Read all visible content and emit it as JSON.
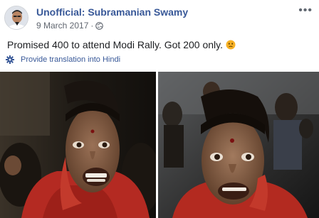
{
  "post": {
    "author": "Unofficial: Subramanian Swamy",
    "date": "9 March 2017",
    "separator": "·",
    "privacy_icon": "globe-icon",
    "more_icon": "ellipsis-icon",
    "more_label": "•••",
    "text": "Promised 400 to attend Modi Rally. Got 200 only.",
    "emoji_icon": "confused-face-icon",
    "translate_icon": "gear-icon",
    "translate_label": "Provide translation into Hindi"
  },
  "colors": {
    "link": "#385898",
    "text": "#1c1e21",
    "secondary_text": "#616770",
    "emoji": "#f7b125"
  }
}
